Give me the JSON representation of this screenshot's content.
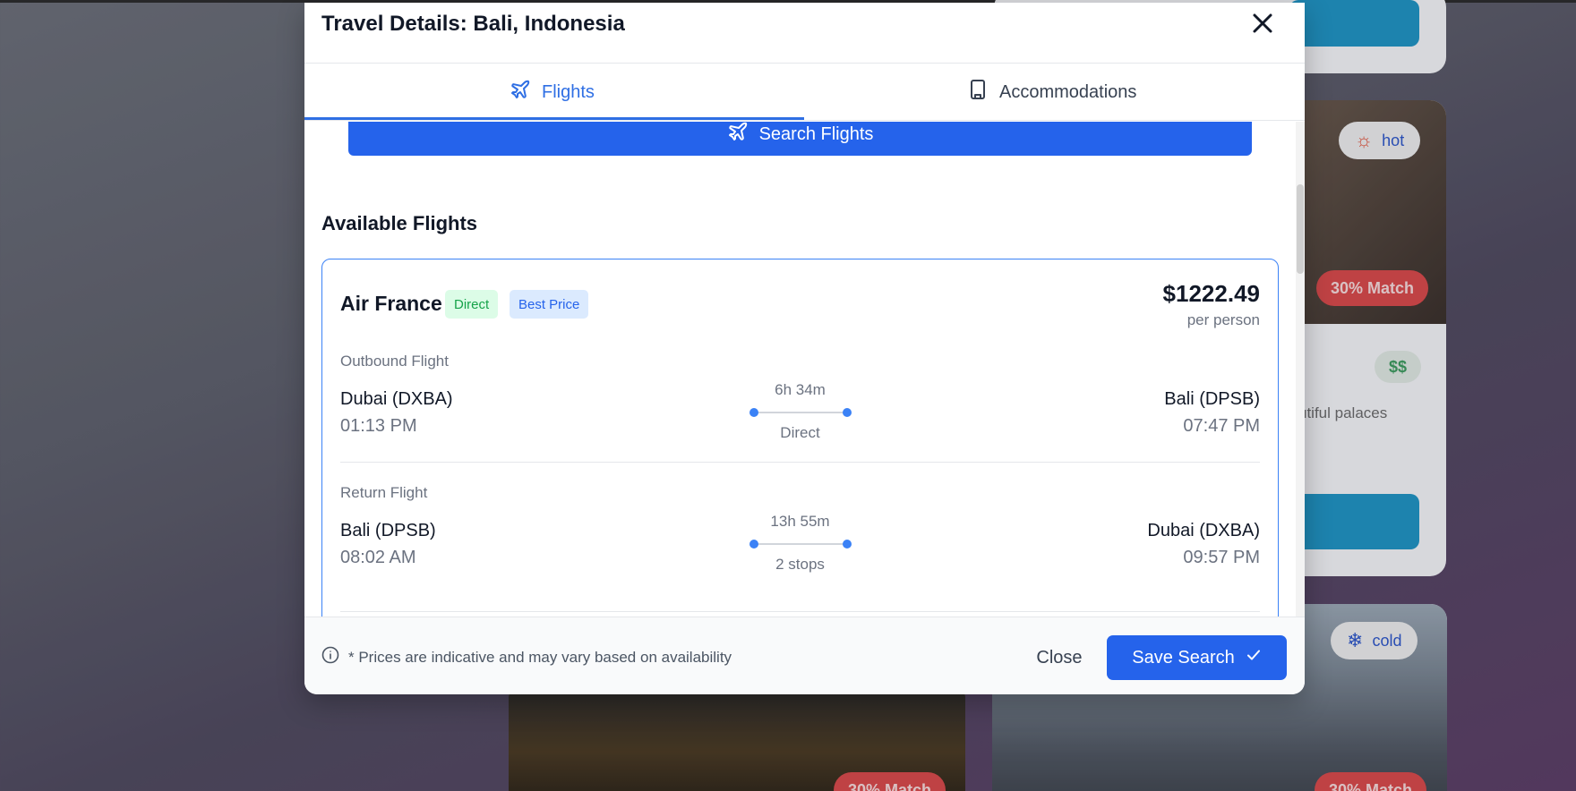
{
  "modal": {
    "title": "Travel Details: Bali, Indonesia",
    "tabs": [
      {
        "label": "Flights",
        "icon": "plane-icon",
        "active": true
      },
      {
        "label": "Accommodations",
        "icon": "building-icon",
        "active": false
      }
    ],
    "search_button": "Search Flights",
    "section_title": "Available Flights",
    "flight": {
      "airline": "Air France",
      "badges": [
        "Direct",
        "Best Price"
      ],
      "price": "$1222.49",
      "price_unit": "per person",
      "outbound": {
        "label": "Outbound Flight",
        "from_city": "Dubai (DXBA)",
        "from_time": "01:13 PM",
        "duration": "6h 34m",
        "stops": "Direct",
        "to_city": "Bali (DPSB)",
        "to_time": "07:47 PM"
      },
      "return": {
        "label": "Return Flight",
        "from_city": "Bali (DPSB)",
        "from_time": "08:02 AM",
        "duration": "13h 55m",
        "stops": "2 stops",
        "to_city": "Dubai (DXBA)",
        "to_time": "09:57 PM"
      }
    },
    "footer": {
      "note": "* Prices are indicative and may vary based on availability",
      "close_label": "Close",
      "save_label": "Save Search"
    }
  },
  "background": {
    "chips": [
      "hot",
      "cold"
    ],
    "match_label": "30% Match",
    "price_level": "$$",
    "text_fragment": "utiful palaces"
  },
  "colors": {
    "accent": "#2563eb",
    "card_border": "#3b82f6",
    "badge_direct": "#16a34a",
    "badge_best": "#2563eb",
    "match": "#d84949"
  }
}
